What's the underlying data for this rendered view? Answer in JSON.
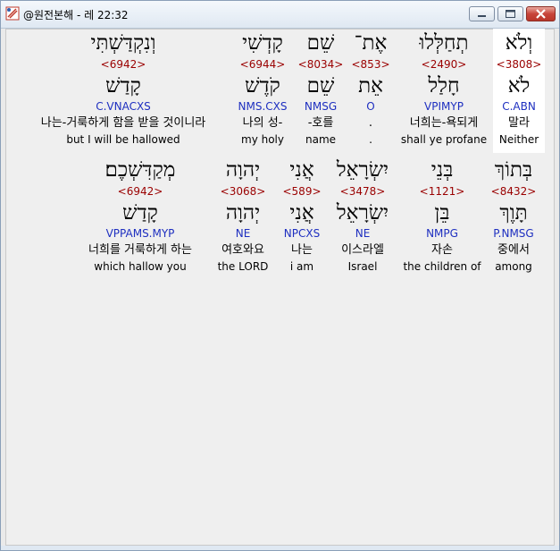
{
  "window": {
    "title": "@원전본해 - 레 22:32",
    "buttons": {
      "minimize": "minimize-icon",
      "maximize": "maximize-icon",
      "close": "close-icon"
    }
  },
  "rows": [
    [
      {
        "hebrew": "וְלֹא",
        "strong": "<3808>",
        "lemma": "לֹא",
        "morph": "C.ABN",
        "korean": "말라",
        "english": "Neither"
      },
      {
        "hebrew": "תְחַלְּלוּ",
        "strong": "<2490>",
        "lemma": "חָלַל",
        "morph": "VPIMYP",
        "korean": "너희는-욕되게",
        "english": "shall ye profane"
      },
      {
        "hebrew": "אֶת־",
        "strong": "<853>",
        "lemma": "אֵת",
        "morph": "O",
        "korean": ".",
        "english": "."
      },
      {
        "hebrew": "שֵׁם",
        "strong": "<8034>",
        "lemma": "שֵׁם",
        "morph": "NMSG",
        "korean": "-호를",
        "english": "name"
      },
      {
        "hebrew": "קָדְשִׁי",
        "strong": "<6944>",
        "lemma": "קֹדֶשׁ",
        "morph": "NMS.CXS",
        "korean": "나의 성-",
        "english": "my holy"
      },
      {
        "hebrew": "וְנִקְדַּשְׁתִּי",
        "strong": "<6942>",
        "lemma": "קָדַשׁ",
        "morph": "C.VNACXS",
        "korean": "나는-거룩하게 함을 받을 것이니라",
        "english": "but I will be hallowed"
      }
    ],
    [
      {
        "hebrew": "בְּתוֹךְ",
        "strong": "<8432>",
        "lemma": "תָּוֶךְ",
        "morph": "P.NMSG",
        "korean": "중에서",
        "english": "among"
      },
      {
        "hebrew": "בְּנֵי",
        "strong": "<1121>",
        "lemma": "בֵּן",
        "morph": "NMPG",
        "korean": "자손",
        "english": "the children of"
      },
      {
        "hebrew": "יִשְׂרָאֵל",
        "strong": "<3478>",
        "lemma": "יִשְׂרָאֵל",
        "morph": "NE",
        "korean": "이스라엘",
        "english": "Israel"
      },
      {
        "hebrew": "אֲנִי",
        "strong": "<589>",
        "lemma": "אֲנִי",
        "morph": "NPCXS",
        "korean": "나는",
        "english": "i am"
      },
      {
        "hebrew": "יְהוָה",
        "strong": "<3068>",
        "lemma": "יְהוָה",
        "morph": "NE",
        "korean": "여호와요",
        "english": "the LORD"
      },
      {
        "hebrew": "מְקַדִּשְׁכֶם׃",
        "strong": "<6942>",
        "lemma": "קָדַשׁ",
        "morph": "VPPAMS.MYP",
        "korean": "너희를 거룩하게 하는",
        "english": "which hallow you"
      }
    ]
  ],
  "colors": {
    "strong": "#9a0000",
    "morph": "#1e2fc0",
    "highlight": "#ffffff",
    "background": "#efefef"
  }
}
